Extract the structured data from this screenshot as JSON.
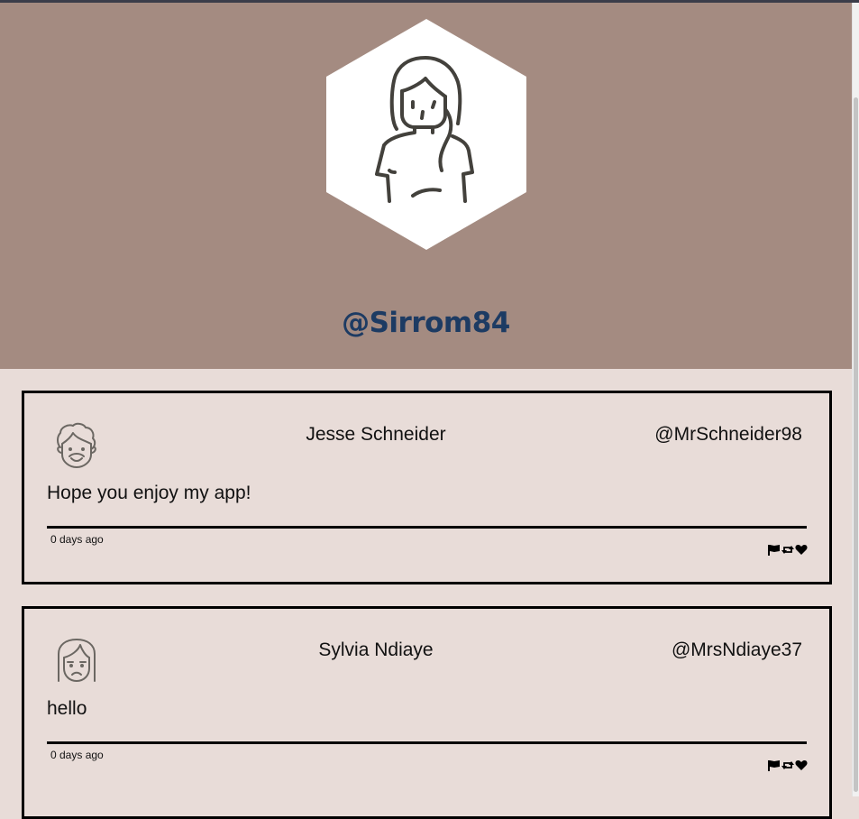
{
  "profile": {
    "handle": "@Sirrom84",
    "avatar_icon": "woman-long-hair-avatar-icon"
  },
  "colors": {
    "header_bg": "#a48b81",
    "page_bg": "#e8dcd8",
    "handle_color": "#1d3b63"
  },
  "posts": [
    {
      "avatar_icon": "curly-hair-man-avatar-icon",
      "name": "Jesse Schneider",
      "handle": "@MrSchneider98",
      "text": "Hope you enjoy my app!",
      "time": "0 days ago",
      "actions": [
        "flag-icon",
        "retweet-icon",
        "heart-icon"
      ]
    },
    {
      "avatar_icon": "sad-woman-avatar-icon",
      "name": "Sylvia Ndiaye",
      "handle": "@MrsNdiaye37",
      "text": "hello",
      "time": "0 days ago",
      "actions": [
        "flag-icon",
        "retweet-icon",
        "heart-icon"
      ]
    }
  ]
}
